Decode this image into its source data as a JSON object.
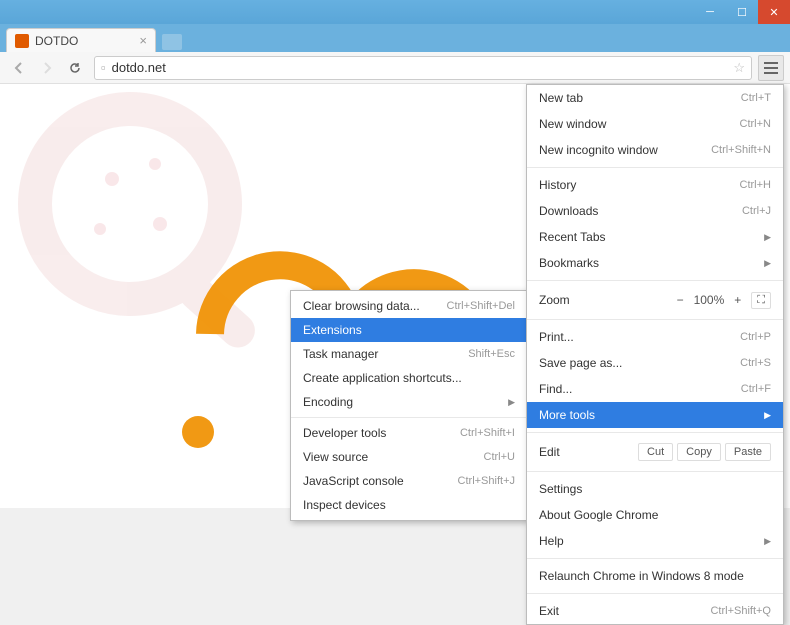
{
  "window": {
    "title": "DOTDO"
  },
  "tab": {
    "title": "DOTDO"
  },
  "address": {
    "url": "dotdo.net"
  },
  "menu": {
    "new_tab": {
      "label": "New tab",
      "shortcut": "Ctrl+T"
    },
    "new_window": {
      "label": "New window",
      "shortcut": "Ctrl+N"
    },
    "new_incognito": {
      "label": "New incognito window",
      "shortcut": "Ctrl+Shift+N"
    },
    "history": {
      "label": "History",
      "shortcut": "Ctrl+H"
    },
    "downloads": {
      "label": "Downloads",
      "shortcut": "Ctrl+J"
    },
    "recent_tabs": {
      "label": "Recent Tabs"
    },
    "bookmarks": {
      "label": "Bookmarks"
    },
    "zoom": {
      "label": "Zoom",
      "value": "100%"
    },
    "print": {
      "label": "Print...",
      "shortcut": "Ctrl+P"
    },
    "save_as": {
      "label": "Save page as...",
      "shortcut": "Ctrl+S"
    },
    "find": {
      "label": "Find...",
      "shortcut": "Ctrl+F"
    },
    "more_tools": {
      "label": "More tools"
    },
    "edit": {
      "label": "Edit",
      "cut": "Cut",
      "copy": "Copy",
      "paste": "Paste"
    },
    "settings": {
      "label": "Settings"
    },
    "about": {
      "label": "About Google Chrome"
    },
    "help": {
      "label": "Help"
    },
    "relaunch": {
      "label": "Relaunch Chrome in Windows 8 mode"
    },
    "exit": {
      "label": "Exit",
      "shortcut": "Ctrl+Shift+Q"
    }
  },
  "submenu": {
    "clear_browsing": {
      "label": "Clear browsing data...",
      "shortcut": "Ctrl+Shift+Del"
    },
    "extensions": {
      "label": "Extensions"
    },
    "task_manager": {
      "label": "Task manager",
      "shortcut": "Shift+Esc"
    },
    "create_shortcuts": {
      "label": "Create application shortcuts..."
    },
    "encoding": {
      "label": "Encoding"
    },
    "dev_tools": {
      "label": "Developer tools",
      "shortcut": "Ctrl+Shift+I"
    },
    "view_source": {
      "label": "View source",
      "shortcut": "Ctrl+U"
    },
    "js_console": {
      "label": "JavaScript console",
      "shortcut": "Ctrl+Shift+J"
    },
    "inspect_devices": {
      "label": "Inspect devices"
    }
  }
}
